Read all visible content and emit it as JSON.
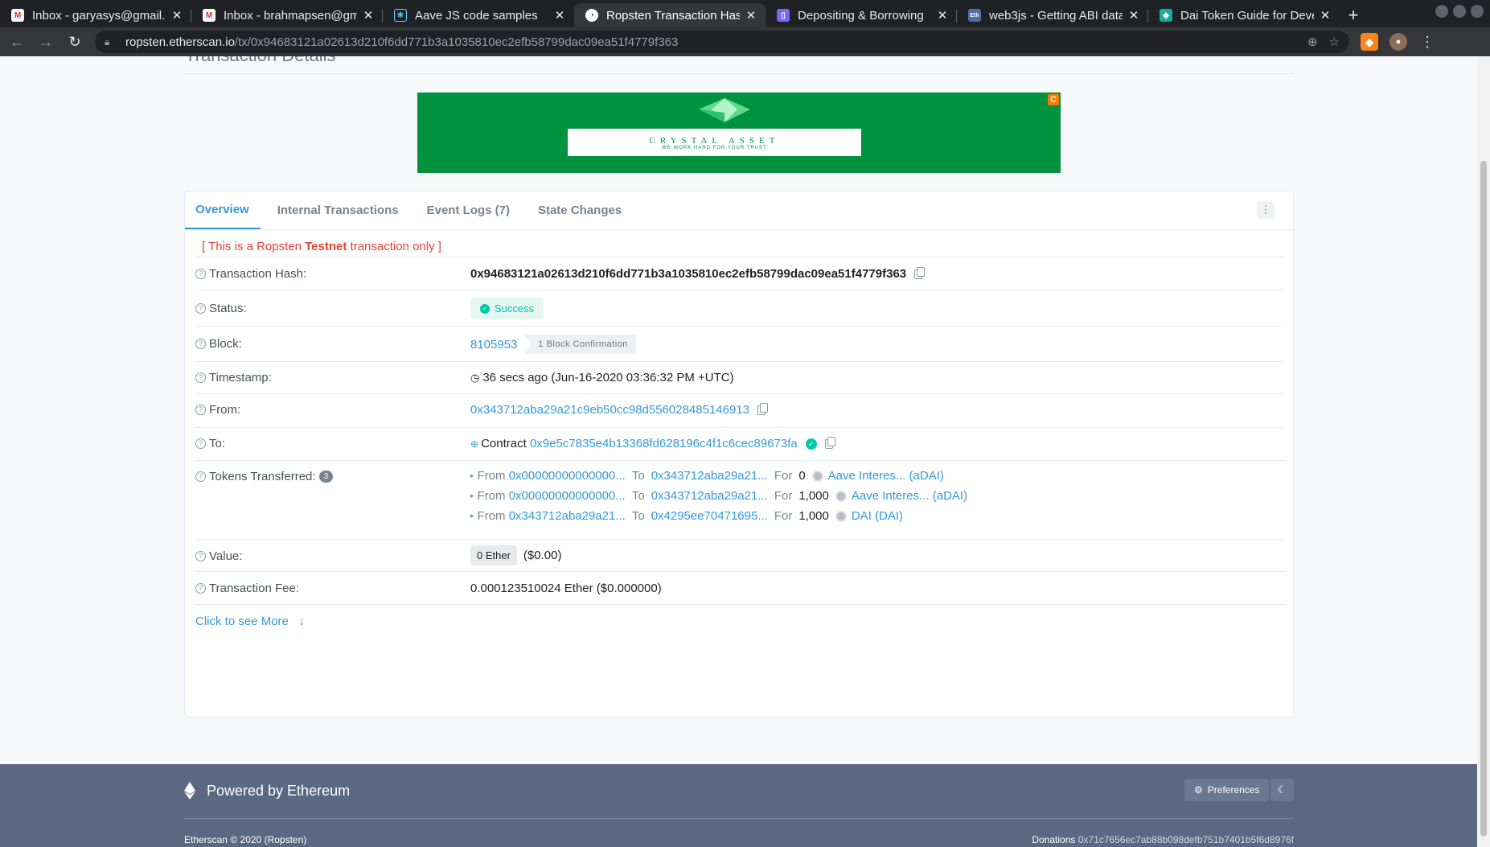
{
  "browser": {
    "tabs": [
      {
        "title": "Inbox - garyasys@gmail.c",
        "icon": "gmail-icon",
        "active": false
      },
      {
        "title": "Inbox - brahmapsen@gm",
        "icon": "gmail-icon",
        "active": false
      },
      {
        "title": "Aave JS code samples",
        "icon": "react-icon",
        "active": false
      },
      {
        "title": "Ropsten Transaction Has",
        "icon": "etherscan-icon",
        "active": true
      },
      {
        "title": "Depositing & Borrowing",
        "icon": "gitbook-icon",
        "active": false
      },
      {
        "title": "web3js - Getting ABI data",
        "icon": "ethereum-se-icon",
        "active": false
      },
      {
        "title": "Dai Token Guide for Devel",
        "icon": "dai-icon",
        "active": false
      }
    ],
    "close_glyph": "✕",
    "new_tab_glyph": "+",
    "url_host": "ropsten.etherscan.io",
    "url_path": "/tx/0x94683121a02613d210f6dd771b3a1035810ec2efb58799dac09ea51f4779f363"
  },
  "page": {
    "heading": "Transaction Details",
    "ad": {
      "title": "CRYSTAL ASSET",
      "subtitle": "WE WORK HARD FOR YOUR TRUST",
      "badge": "C"
    },
    "tabs": [
      "Overview",
      "Internal Transactions",
      "Event Logs (7)",
      "State Changes"
    ],
    "notice_prefix": "[ This is a Ropsten ",
    "notice_bold": "Testnet",
    "notice_suffix": " transaction only ]",
    "fields": {
      "hash_label": "Transaction Hash:",
      "hash_value": "0x94683121a02613d210f6dd771b3a1035810ec2efb58799dac09ea51f4779f363",
      "status_label": "Status:",
      "status_value": "Success",
      "block_label": "Block:",
      "block_value": "8105953",
      "block_confirmations": "1 Block Confirmation",
      "timestamp_label": "Timestamp:",
      "timestamp_value": "36 secs ago (Jun-16-2020 03:36:32 PM +UTC)",
      "from_label": "From:",
      "from_value": "0x343712aba29a21c9eb50cc98d556028485146913",
      "to_label": "To:",
      "to_prefix": "Contract",
      "to_value": "0x9e5c7835e4b13368fd628196c4f1c6cec89673fa",
      "tokens_label": "Tokens Transferred:",
      "tokens_count": "3",
      "value_label": "Value:",
      "value_amount": "0 Ether",
      "value_usd": "($0.00)",
      "fee_label": "Transaction Fee:",
      "fee_value": "0.000123510024 Ether ($0.000000)"
    },
    "transfers": [
      {
        "from": "0x00000000000000...",
        "to": "0x343712aba29a21...",
        "amount": "0",
        "token": "Aave Interes... (aDAI)"
      },
      {
        "from": "0x00000000000000...",
        "to": "0x343712aba29a21...",
        "amount": "1,000",
        "token": "Aave Interes... (aDAI)"
      },
      {
        "from": "0x343712aba29a21...",
        "to": "0x4295ee70471695...",
        "amount": "1,000",
        "token": "DAI (DAI)"
      }
    ],
    "transfer_words": {
      "from": "From",
      "to": "To",
      "for": "For"
    },
    "see_more": "Click to see More"
  },
  "footer": {
    "powered": "Powered by Ethereum",
    "preferences": "Preferences",
    "copyright": "Etherscan © 2020 (Ropsten)",
    "donations_label": "Donations",
    "donations_address": "0x71c7656ec7ab88b098defb751b7401b5f6d8976f"
  },
  "colors": {
    "link": "#3498db",
    "success": "#00c9a7",
    "danger": "#de4437",
    "ad_green": "#00923f",
    "footer": "#5a6882"
  }
}
